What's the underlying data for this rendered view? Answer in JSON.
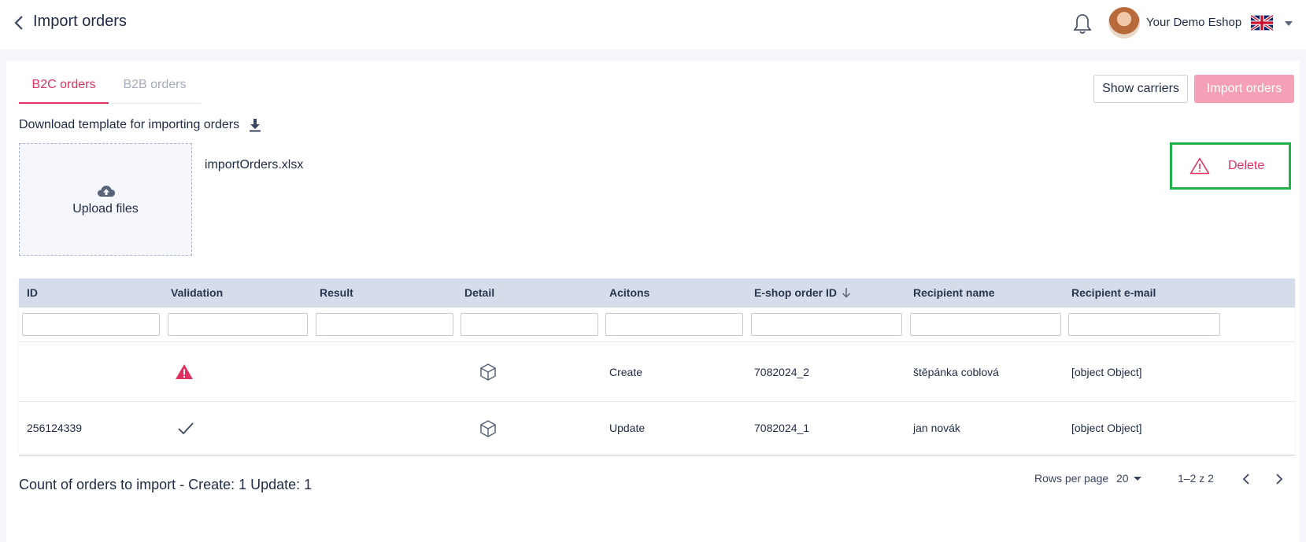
{
  "header": {
    "title": "Import orders",
    "shop_name": "Your Demo Eshop",
    "language": "en-GB"
  },
  "tabs": [
    {
      "label": "B2C orders",
      "active": true
    },
    {
      "label": "B2B orders",
      "active": false
    }
  ],
  "actions": {
    "show_carriers": "Show carriers",
    "import_orders": "Import orders"
  },
  "download": {
    "label": "Download template for importing orders"
  },
  "upload": {
    "label": "Upload files",
    "file_name": "importOrders.xlsx"
  },
  "delete": {
    "label": "Delete"
  },
  "table": {
    "columns": [
      "ID",
      "Validation",
      "Result",
      "Detail",
      "Acitons",
      "E-shop order ID",
      "Recipient name",
      "Recipient e-mail"
    ],
    "rows": [
      {
        "id": "",
        "validation": "warning-icon",
        "result": "",
        "detail": "box-icon",
        "action": "Create",
        "eshop_order_id": "7082024_2",
        "recipient_name": "štěpánka coblová",
        "recipient_email": "[object Object]"
      },
      {
        "id": "256124339",
        "validation": "check-icon",
        "result": "",
        "detail": "box-icon",
        "action": "Update",
        "eshop_order_id": "7082024_1",
        "recipient_name": "jan novák",
        "recipient_email": "[object Object]"
      }
    ]
  },
  "pagination": {
    "rows_per_page_label": "Rows per page",
    "rows_per_page": "20",
    "range": "1–2 z 2"
  },
  "summary": "Count of orders to import - Create: 1 Update: 1",
  "colors": {
    "accent": "#e0325f",
    "accent_light": "#f4a0b7",
    "highlight_border": "#22b24c",
    "table_header": "#d5dcea"
  }
}
